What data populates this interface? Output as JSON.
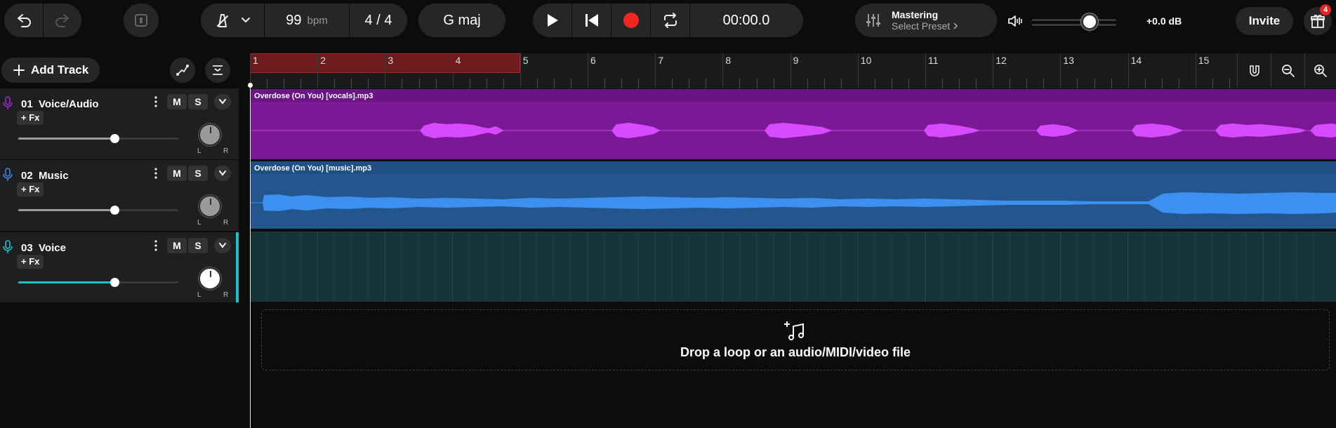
{
  "toolbar": {
    "tempo_value": "99",
    "tempo_unit": "bpm",
    "time_signature": "4 / 4",
    "key": "G maj",
    "timer": "00:00.0",
    "mastering_title": "Mastering",
    "mastering_preset": "Select Preset",
    "master_volume_level": 0.68,
    "gain": "+0.0 dB",
    "invite_label": "Invite",
    "gift_badge": "4"
  },
  "left_panel": {
    "add_track_label": "Add Track"
  },
  "tracks": [
    {
      "number": "01",
      "name": "Voice/Audio",
      "fx_label": "+ Fx",
      "mute_label": "M",
      "solo_label": "S",
      "volume_level": 0.6,
      "color": "#a424c8"
    },
    {
      "number": "02",
      "name": "Music",
      "fx_label": "+ Fx",
      "mute_label": "M",
      "solo_label": "S",
      "volume_level": 0.6,
      "color": "#3d86e0"
    },
    {
      "number": "03",
      "name": "Voice",
      "fx_label": "+ Fx",
      "mute_label": "M",
      "solo_label": "S",
      "volume_level": 0.6,
      "color": "#19c2cc"
    }
  ],
  "ruler": {
    "bars": [
      "1",
      "2",
      "3",
      "4",
      "5",
      "6",
      "7",
      "8",
      "9",
      "10",
      "11",
      "12",
      "13",
      "14",
      "15"
    ],
    "loop_bars": [
      1,
      4
    ]
  },
  "clips": [
    {
      "name": "Overdose (On You) [vocals].mp3",
      "color": "#7a1896"
    },
    {
      "name": "Overdose (On You) [music].mp3",
      "color": "#24568e"
    }
  ],
  "dropzone": {
    "label": "Drop a loop or an audio/MIDI/video file"
  }
}
